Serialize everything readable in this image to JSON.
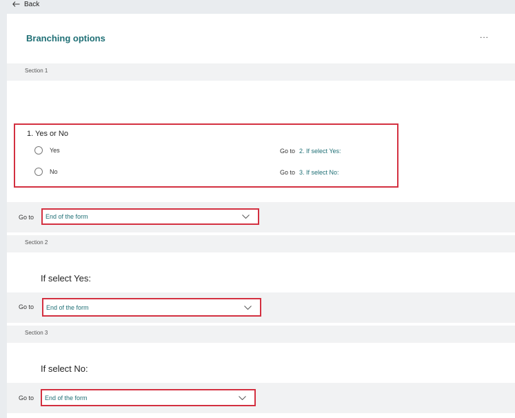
{
  "back_label": "Back",
  "title": "Branching options",
  "more_label": "...",
  "sections": [
    {
      "label": "Section 1",
      "question": {
        "title": "1. Yes or No",
        "options": [
          {
            "label": "Yes",
            "goto_label": "Go to",
            "target": "2. If select Yes:"
          },
          {
            "label": "No",
            "goto_label": "Go to",
            "target": "3. If select No:"
          }
        ]
      },
      "goto_label": "Go to",
      "goto_value": "End of the form"
    },
    {
      "label": "Section 2",
      "text": "If select Yes:",
      "goto_label": "Go to",
      "goto_value": "End of the form"
    },
    {
      "label": "Section 3",
      "text": "If select No:",
      "goto_label": "Go to",
      "goto_value": "End of the form"
    }
  ],
  "colors": {
    "accent": "#1f6f75",
    "highlight": "#d32f3f",
    "band": "#f1f2f3"
  }
}
